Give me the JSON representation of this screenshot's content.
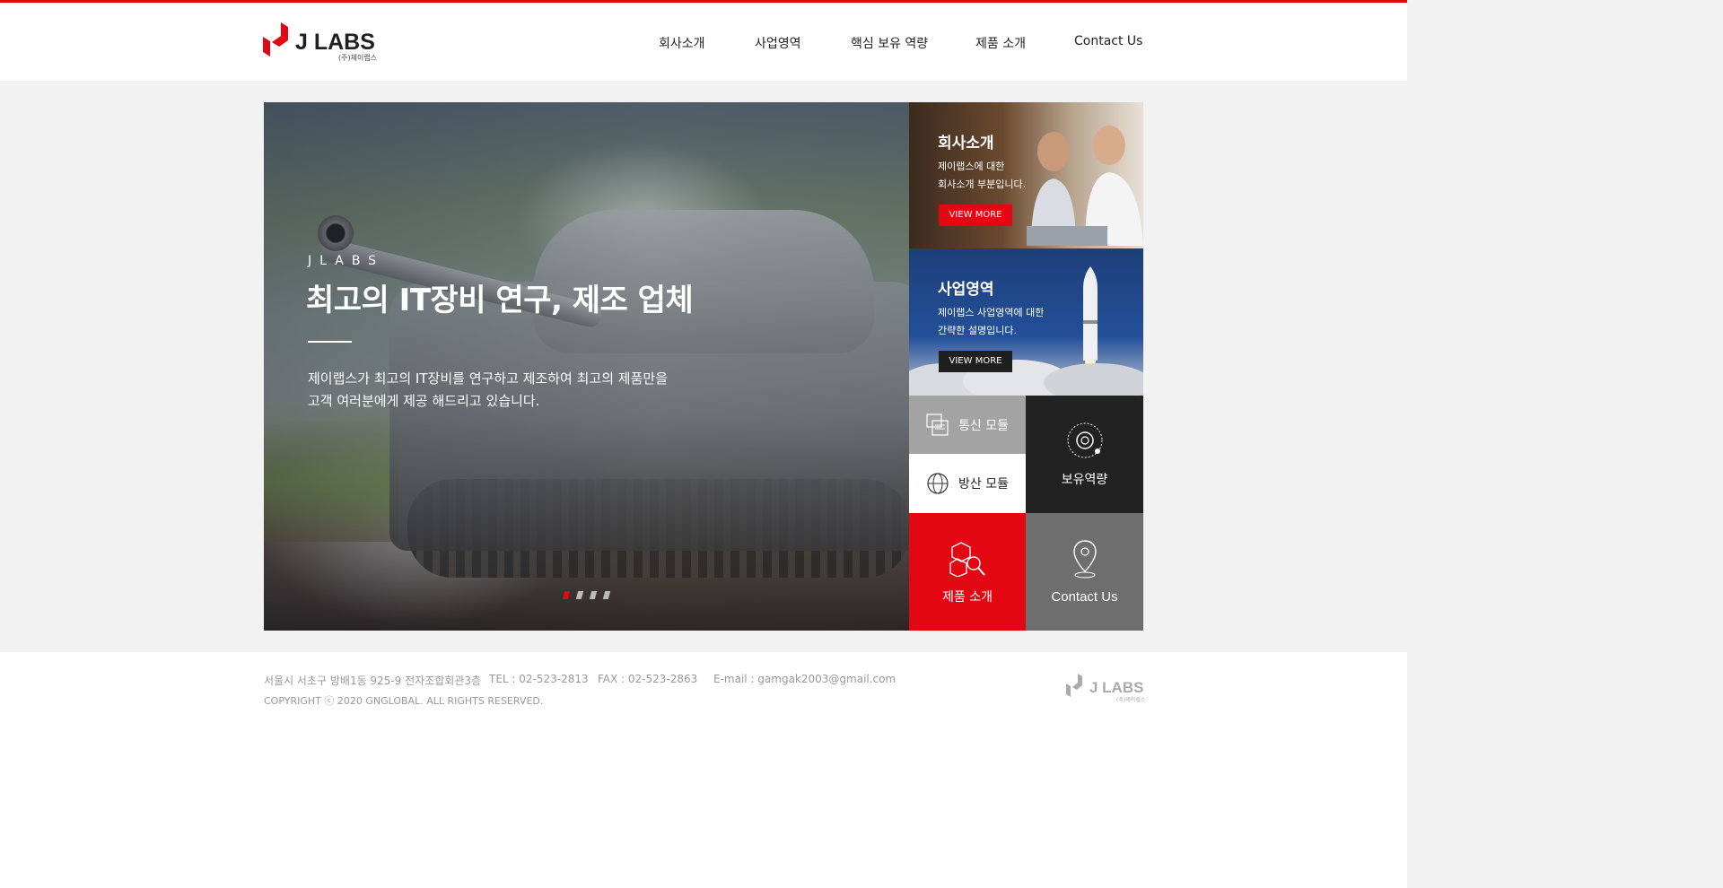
{
  "brand": {
    "name": "J LABS",
    "sub": "(주)제이랩스",
    "accent": "#e30613"
  },
  "nav": {
    "items": [
      "회사소개",
      "사업영역",
      "핵심 보유 역량",
      "제품 소개",
      "Contact Us"
    ]
  },
  "hero": {
    "eyebrow": "JLABS",
    "title": "최고의 IT장비 연구, 제조 업체",
    "desc_line1": "제이랩스가 최고의 IT장비를 연구하고 제조하여 최고의 제품만을",
    "desc_line2": "고객 여러분에게 제공 해드리고 있습니다.",
    "slides_total": 4,
    "slide_active": 1
  },
  "cards": {
    "about": {
      "title": "회사소개",
      "line1": "제이랩스에 대한",
      "line2": "회사소개 부분입니다.",
      "button": "VIEW MORE"
    },
    "business": {
      "title": "사업영역",
      "line1": "제이랩스 사업영역에 대한",
      "line2": "간략한 설명입니다.",
      "button": "VIEW MORE"
    }
  },
  "tiles": {
    "comm": "통신 모듈",
    "defense": "방산 모듈",
    "capability": "보유역량",
    "products": "제품 소개",
    "contact": "Contact Us"
  },
  "footer": {
    "address": "서울시 서초구 방배1동 925-9 전자조합회관3층",
    "tel": "TEL : 02-523-2813",
    "fax": "FAX : 02-523-2863",
    "email": "E-mail : gamgak2003@gmail.com",
    "copyright": "COPYRIGHT ⓒ 2020 GNGLOBAL. ALL RIGHTS RESERVED.",
    "logo": "J LABS",
    "logo_sub": "(주)제이랩스"
  }
}
